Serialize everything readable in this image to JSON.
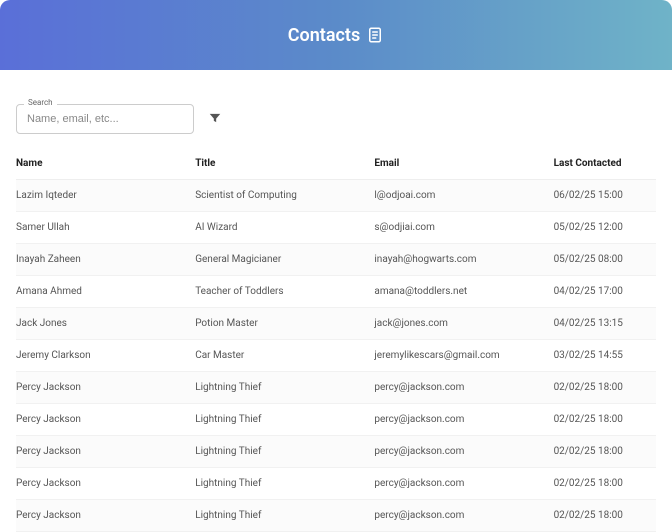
{
  "header": {
    "title": "Contacts",
    "icon": "contacts-icon"
  },
  "search": {
    "label": "Search",
    "placeholder": "Name, email, etc...",
    "value": ""
  },
  "filter": {
    "icon": "filter-icon"
  },
  "table": {
    "columns": {
      "name": "Name",
      "title": "Title",
      "email": "Email",
      "last_contacted": "Last Contacted"
    },
    "rows": [
      {
        "name": "Lazim Iqteder",
        "title": "Scientist of Computing",
        "email": "l@odjoai.com",
        "last_contacted": "06/02/25 15:00"
      },
      {
        "name": "Samer Ullah",
        "title": "AI Wizard",
        "email": "s@odjiai.com",
        "last_contacted": "05/02/25 12:00"
      },
      {
        "name": "Inayah Zaheen",
        "title": "General Magicianer",
        "email": "inayah@hogwarts.com",
        "last_contacted": "05/02/25 08:00"
      },
      {
        "name": "Amana Ahmed",
        "title": "Teacher of Toddlers",
        "email": "amana@toddlers.net",
        "last_contacted": "04/02/25 17:00"
      },
      {
        "name": "Jack Jones",
        "title": "Potion Master",
        "email": "jack@jones.com",
        "last_contacted": "04/02/25 13:15"
      },
      {
        "name": "Jeremy Clarkson",
        "title": "Car Master",
        "email": "jeremylikescars@gmail.com",
        "last_contacted": "03/02/25 14:55"
      },
      {
        "name": "Percy Jackson",
        "title": "Lightning Thief",
        "email": "percy@jackson.com",
        "last_contacted": "02/02/25 18:00"
      },
      {
        "name": "Percy Jackson",
        "title": "Lightning Thief",
        "email": "percy@jackson.com",
        "last_contacted": "02/02/25 18:00"
      },
      {
        "name": "Percy Jackson",
        "title": "Lightning Thief",
        "email": "percy@jackson.com",
        "last_contacted": "02/02/25 18:00"
      },
      {
        "name": "Percy Jackson",
        "title": "Lightning Thief",
        "email": "percy@jackson.com",
        "last_contacted": "02/02/25 18:00"
      },
      {
        "name": "Percy Jackson",
        "title": "Lightning Thief",
        "email": "percy@jackson.com",
        "last_contacted": "02/02/25 18:00"
      }
    ]
  }
}
